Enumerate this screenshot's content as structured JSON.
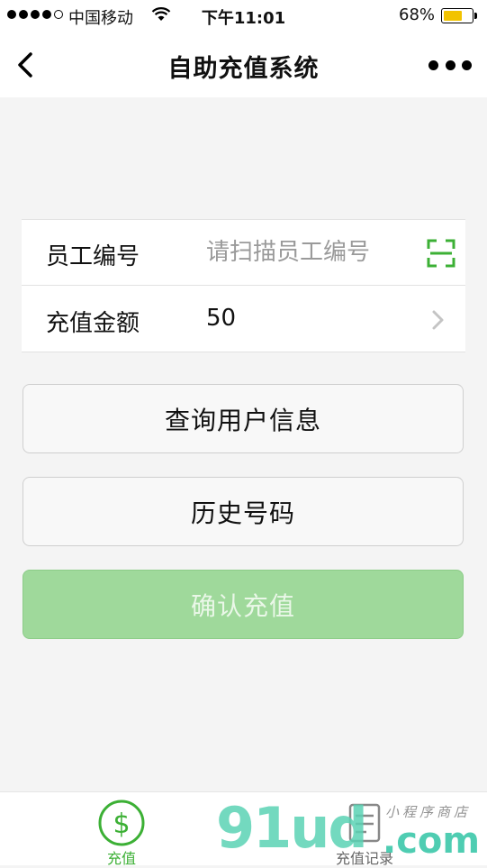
{
  "status_bar": {
    "carrier": "中国移动",
    "time": "下午11:01",
    "battery_percent": "68%",
    "battery_level": 0.68
  },
  "nav": {
    "title": "自助充值系统",
    "back_icon": "chevron-left-icon",
    "more_icon": "more-dots-icon"
  },
  "form": {
    "employee_id_label": "员工编号",
    "employee_id_value": "",
    "employee_id_placeholder": "请扫描员工编号",
    "scan_icon": "scan-icon",
    "amount_label": "充值金额",
    "amount_value": "50",
    "amount_chevron_icon": "chevron-right-icon"
  },
  "buttons": {
    "query_user": "查询用户信息",
    "history_numbers": "历史号码",
    "confirm_recharge": "确认充值"
  },
  "colors": {
    "accent_green": "#3cb035",
    "confirm_disabled": "#9fd99b",
    "battery_yellow": "#f2c300"
  },
  "tabbar": {
    "tabs": [
      {
        "label": "充值",
        "icon": "dollar-icon",
        "active": true
      },
      {
        "label": "充值记录",
        "icon": "document-icon",
        "active": false
      }
    ]
  },
  "watermark": {
    "brand": "91ud",
    "suffix": ".com",
    "subtitle": "小程序商店"
  }
}
